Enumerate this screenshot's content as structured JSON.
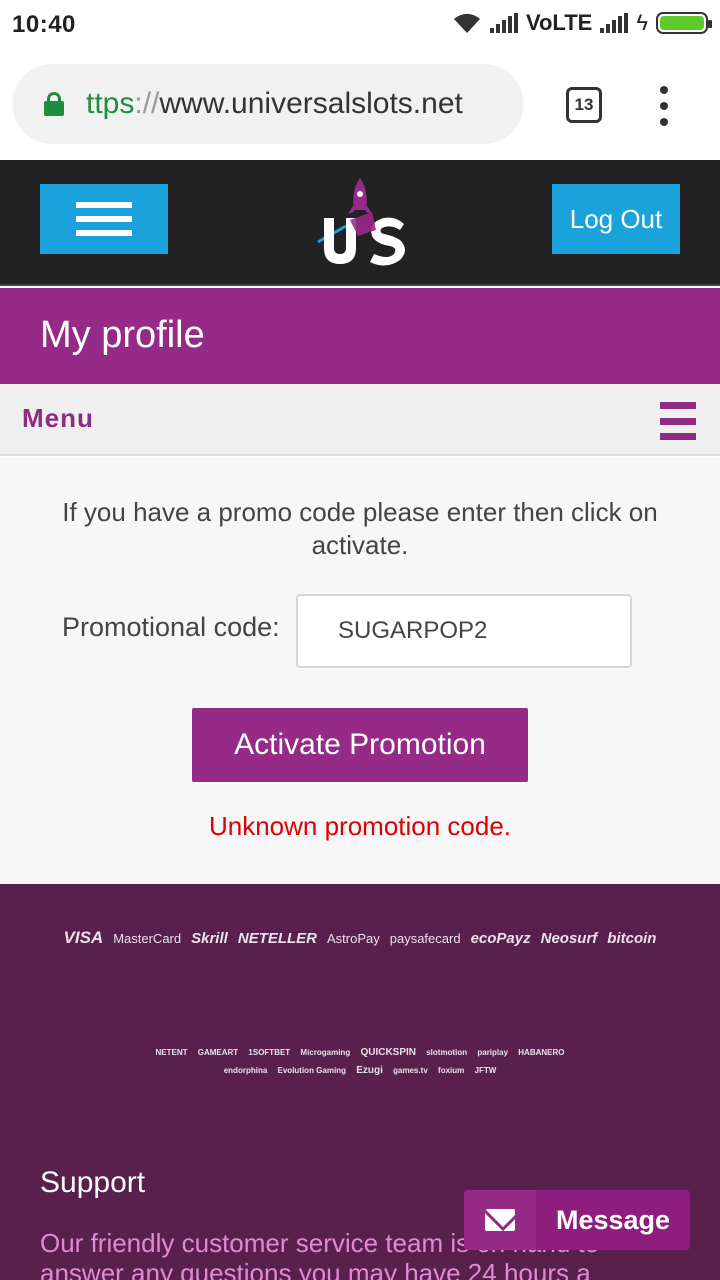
{
  "status_bar": {
    "time": "10:40",
    "network": "VoLTE"
  },
  "browser": {
    "url_scheme": "ttps",
    "url_separator": "://",
    "url_host": "www.universalslots.net",
    "tab_count": "13"
  },
  "header": {
    "logo_text": "US",
    "logout_label": "Log Out"
  },
  "page": {
    "title": "My profile",
    "menu_label": "Menu"
  },
  "promo": {
    "intro": "If you have a promo code please enter then click on activate.",
    "label": "Promotional code:",
    "value": "SUGARPOP2",
    "button_label": "Activate Promotion",
    "error": "Unknown promotion code."
  },
  "footer": {
    "payment_methods": [
      "VISA",
      "MasterCard",
      "Skrill",
      "NETELLER",
      "AstroPay",
      "paysafecard",
      "ecoPayz",
      "Neosurf",
      "bitcoin"
    ],
    "providers": [
      "NETENT",
      "GAMEART",
      "1SOFTBET",
      "Microgaming",
      "QUICKSPIN",
      "slotmotion",
      "pariplay",
      "HABANERO",
      "endorphina",
      "Evolution Gaming",
      "Ezugi",
      "games.tv",
      "foxium",
      "JFTW"
    ],
    "support_title": "Support",
    "support_text": "Our friendly customer service team is on hand to answer any questions you may have 24 hours a"
  },
  "message_button": {
    "label": "Message"
  },
  "colors": {
    "accent_purple": "#962a87",
    "header_dark": "#222222",
    "button_blue": "#1aa3db",
    "footer_purple": "#59204e",
    "error_red": "#e00000"
  }
}
